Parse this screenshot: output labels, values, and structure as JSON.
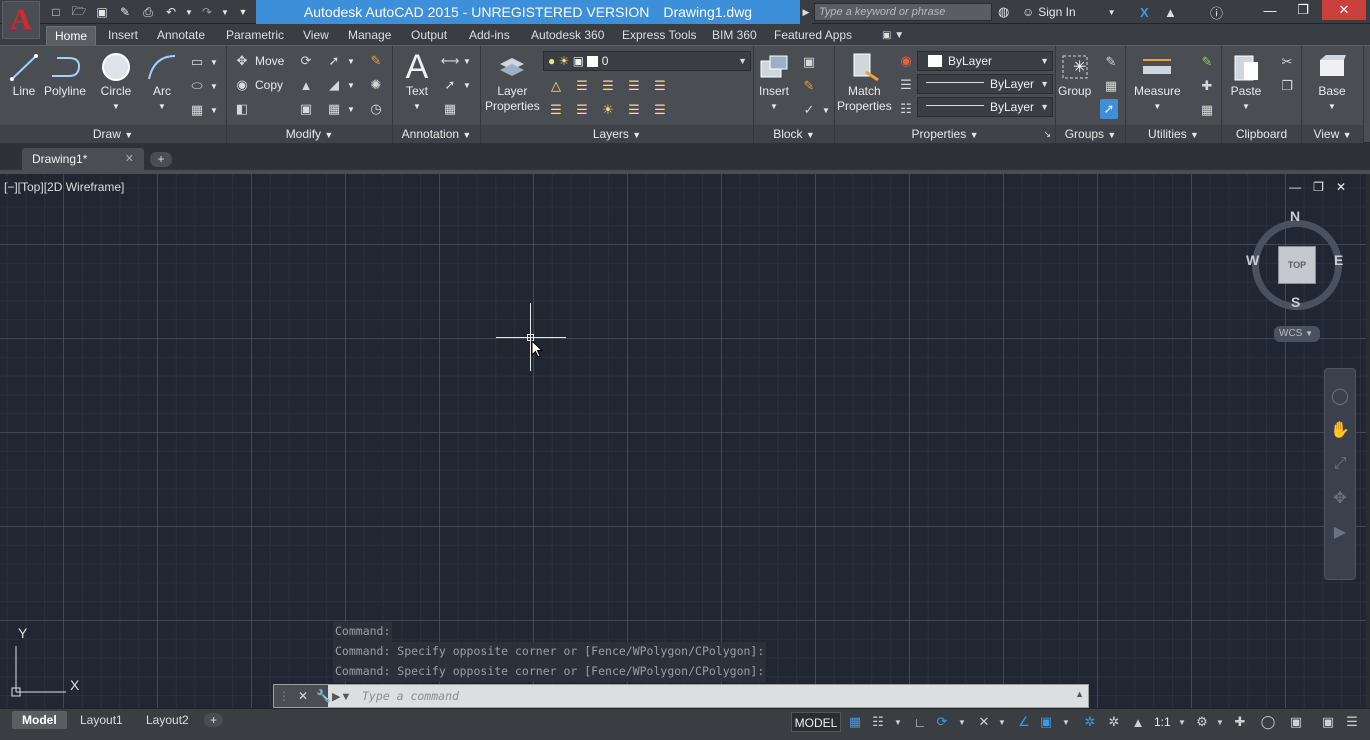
{
  "titlebar": {
    "app_name": "Autodesk AutoCAD 2015 - UNREGISTERED VERSION",
    "file_name": "Drawing1.dwg",
    "search_placeholder": "Type a keyword or phrase",
    "sign_in": "Sign In"
  },
  "tabs": [
    "Home",
    "Insert",
    "Annotate",
    "Parametric",
    "View",
    "Manage",
    "Output",
    "Add-ins",
    "Autodesk 360",
    "Express Tools",
    "BIM 360",
    "Featured Apps"
  ],
  "ribbon": {
    "draw": {
      "title": "Draw",
      "line": "Line",
      "polyline": "Polyline",
      "circle": "Circle",
      "arc": "Arc"
    },
    "modify": {
      "title": "Modify",
      "move": "Move",
      "copy": "Copy"
    },
    "annotation": {
      "title": "Annotation",
      "text": "Text"
    },
    "layers": {
      "title": "Layers",
      "layer_properties": "Layer\nProperties",
      "layer_properties_1": "Layer",
      "layer_properties_2": "Properties",
      "current_layer": "0"
    },
    "block": {
      "title": "Block",
      "insert": "Insert"
    },
    "properties": {
      "title": "Properties",
      "match_1": "Match",
      "match_2": "Properties",
      "color": "ByLayer",
      "linetype": "ByLayer",
      "lineweight": "ByLayer"
    },
    "groups": {
      "title": "Groups",
      "group": "Group"
    },
    "utilities": {
      "title": "Utilities",
      "measure": "Measure"
    },
    "clipboard": {
      "title": "Clipboard",
      "paste": "Paste"
    },
    "view": {
      "title": "View",
      "base": "Base"
    }
  },
  "file_tab": {
    "name": "Drawing1*"
  },
  "viewport": {
    "label": "[−][Top][2D Wireframe]",
    "viewcube": {
      "top": "TOP",
      "n": "N",
      "s": "S",
      "e": "E",
      "w": "W",
      "wcs": "WCS"
    }
  },
  "ucs": {
    "x": "X",
    "y": "Y"
  },
  "command": {
    "history": [
      "Command:",
      "Command: Specify opposite corner or [Fence/WPolygon/CPolygon]:",
      "Command: Specify opposite corner or [Fence/WPolygon/CPolygon]:"
    ],
    "placeholder": "Type a command"
  },
  "status": {
    "layouts": [
      "Model",
      "Layout1",
      "Layout2"
    ],
    "model_button": "MODEL",
    "scale": "1:1"
  }
}
